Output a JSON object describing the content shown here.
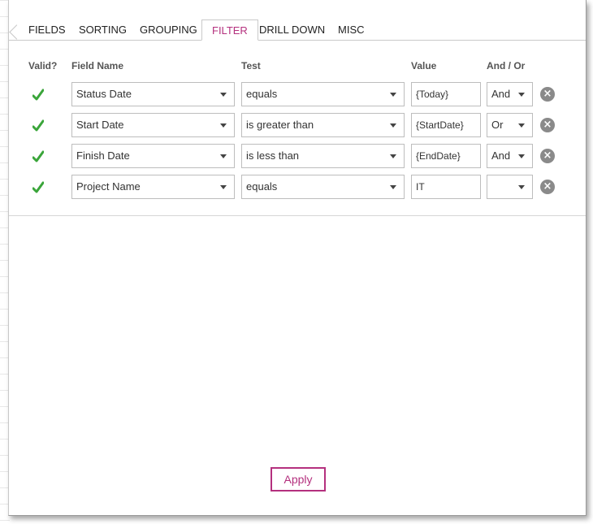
{
  "tabs": [
    {
      "label": "FIELDS"
    },
    {
      "label": "SORTING"
    },
    {
      "label": "GROUPING"
    },
    {
      "label": "FILTER"
    },
    {
      "label": "DRILL DOWN"
    },
    {
      "label": "MISC"
    }
  ],
  "active_tab": "FILTER",
  "headers": {
    "valid": "Valid?",
    "field_name": "Field Name",
    "test": "Test",
    "value": "Value",
    "and_or": "And / Or"
  },
  "rows": [
    {
      "valid": true,
      "field": "Status Date",
      "test": "equals",
      "value": "{Today}",
      "and_or": "And"
    },
    {
      "valid": true,
      "field": "Start Date",
      "test": "is greater than",
      "value": "{StartDate}",
      "and_or": "Or"
    },
    {
      "valid": true,
      "field": "Finish Date",
      "test": "is less than",
      "value": "{EndDate}",
      "and_or": "And"
    },
    {
      "valid": true,
      "field": "Project Name",
      "test": "equals",
      "value": "IT",
      "and_or": ""
    }
  ],
  "apply_label": "Apply",
  "colors": {
    "accent": "#b4307e",
    "check_green": "#3aa53a",
    "delete_gray": "#8a8a8a"
  },
  "icons": {
    "valid": "check-icon",
    "delete": "close-circle-icon",
    "dropdown": "chevron-down-icon"
  }
}
